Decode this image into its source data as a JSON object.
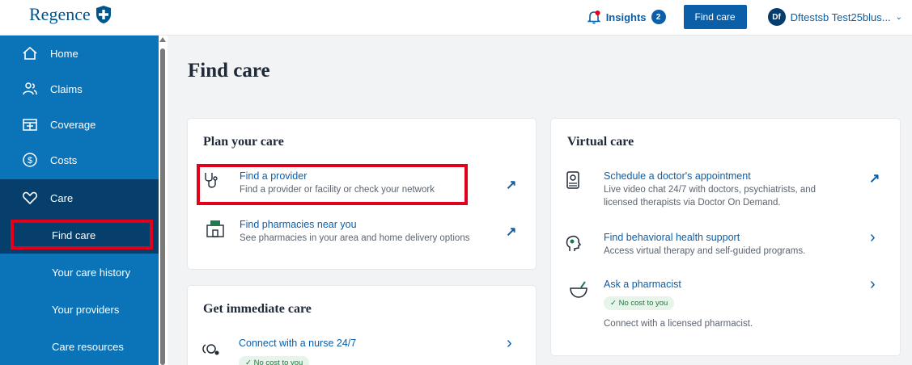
{
  "header": {
    "brand": "Regence",
    "insights_label": "Insights",
    "insights_count": "2",
    "find_care_button": "Find care",
    "user_initials": "Df",
    "user_name": "Dftestsb Test25blus..."
  },
  "sidebar": {
    "items": [
      {
        "label": "Home",
        "icon": "home-icon"
      },
      {
        "label": "Claims",
        "icon": "people-icon"
      },
      {
        "label": "Coverage",
        "icon": "coverage-icon"
      },
      {
        "label": "Costs",
        "icon": "dollar-icon"
      },
      {
        "label": "Care",
        "icon": "heart-icon"
      }
    ],
    "sub_items": [
      {
        "label": "Find care"
      },
      {
        "label": "Your care history"
      },
      {
        "label": "Your providers"
      },
      {
        "label": "Care resources"
      }
    ]
  },
  "main": {
    "title": "Find care",
    "plan_card": {
      "title": "Plan your care",
      "rows": [
        {
          "title": "Find a provider",
          "desc": "Find a provider or facility or check your network",
          "icon": "stethoscope-icon"
        },
        {
          "title": "Find pharmacies near you",
          "desc": "See pharmacies in your area and home delivery options",
          "icon": "pharmacy-icon"
        }
      ]
    },
    "immediate_card": {
      "title": "Get immediate care",
      "rows": [
        {
          "title": "Connect with a nurse 24/7",
          "badge": "✓ No cost to you",
          "icon": "nurse-icon"
        }
      ]
    },
    "virtual_card": {
      "title": "Virtual care",
      "rows": [
        {
          "title": "Schedule a doctor's appointment",
          "desc1": "Live video chat 24/7 with doctors, psychiatrists, and",
          "desc2": "licensed therapists via Doctor On Demand.",
          "icon": "phone-video-icon"
        },
        {
          "title": "Find behavioral health support",
          "desc": "Access virtual therapy and self-guided programs.",
          "icon": "head-icon"
        },
        {
          "title": "Ask a pharmacist",
          "badge": "✓ No cost to you",
          "desc": "Connect with a licensed pharmacist.",
          "icon": "mortar-icon"
        }
      ]
    }
  },
  "colors": {
    "sidebar": "#0b73b8",
    "sidebar_active": "#063f6b",
    "link": "#0b5ea8",
    "highlight": "#e3001b"
  }
}
